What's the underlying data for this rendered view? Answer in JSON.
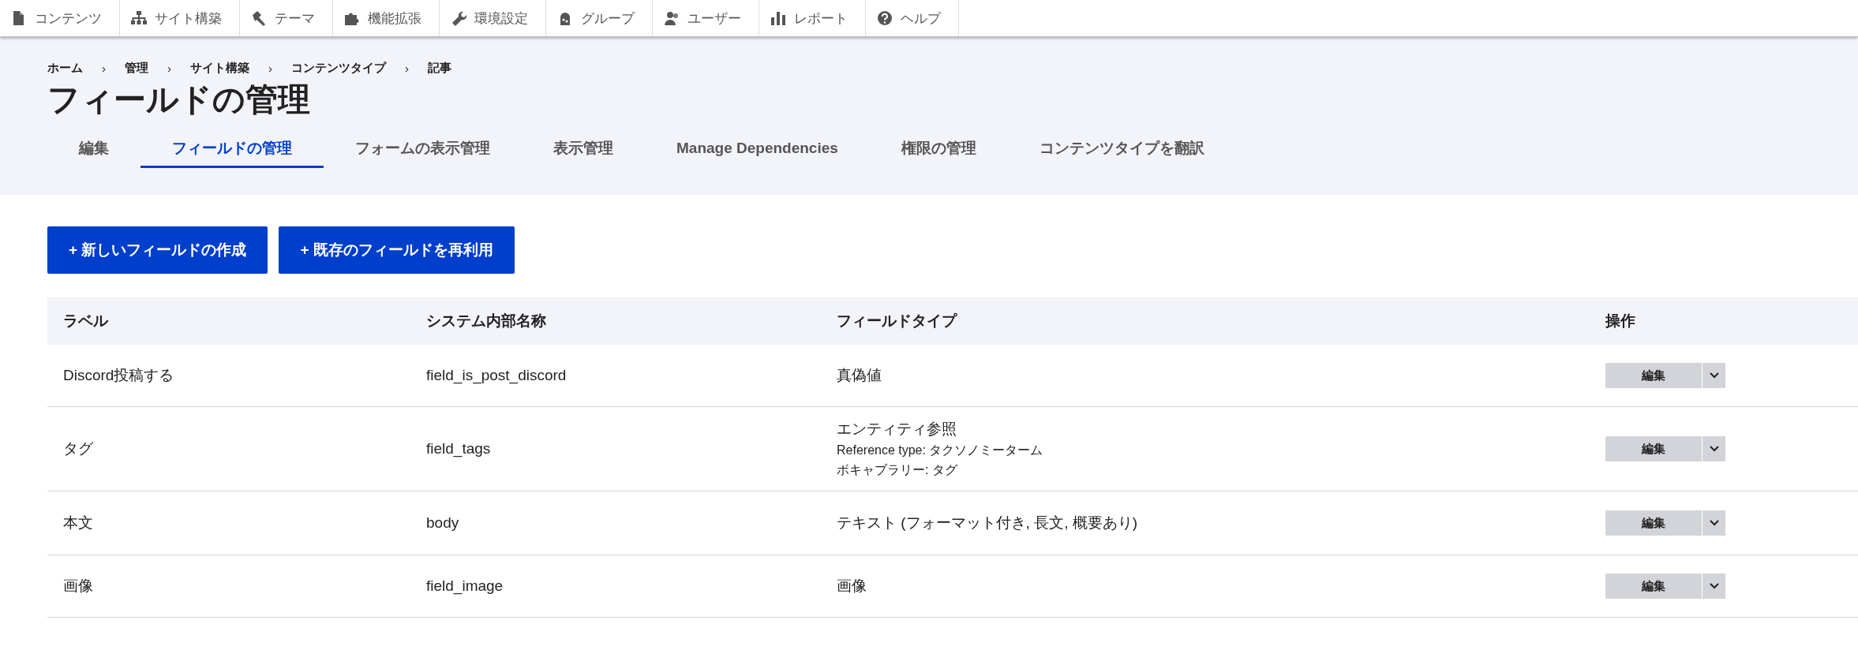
{
  "toolbar": [
    {
      "label": "コンテンツ"
    },
    {
      "label": "サイト構築"
    },
    {
      "label": "テーマ"
    },
    {
      "label": "機能拡張"
    },
    {
      "label": "環境設定"
    },
    {
      "label": "グループ"
    },
    {
      "label": "ユーザー"
    },
    {
      "label": "レポート"
    },
    {
      "label": "ヘルプ"
    }
  ],
  "breadcrumb": [
    "ホーム",
    "管理",
    "サイト構築",
    "コンテンツタイプ",
    "記事"
  ],
  "breadcrumb_separator": "›",
  "page_title": "フィールドの管理",
  "tabs": [
    {
      "label": "編集",
      "selected": false
    },
    {
      "label": "フィールドの管理",
      "selected": true
    },
    {
      "label": "フォームの表示管理",
      "selected": false
    },
    {
      "label": "表示管理",
      "selected": false
    },
    {
      "label": "Manage Dependencies",
      "selected": false
    },
    {
      "label": "権限の管理",
      "selected": false
    },
    {
      "label": "コンテンツタイプを翻訳",
      "selected": false
    }
  ],
  "actions": [
    "+ 新しいフィールドの作成",
    "+ 既存のフィールドを再利用"
  ],
  "table": {
    "columns": [
      "ラベル",
      "システム内部名称",
      "フィールドタイプ",
      "操作"
    ],
    "rows": [
      {
        "label": "Discord投稿する",
        "machine_name": "field_is_post_discord",
        "field_type": "真偽値",
        "details": [],
        "operation": "編集"
      },
      {
        "label": "タグ",
        "machine_name": "field_tags",
        "field_type": "エンティティ参照",
        "details": [
          "Reference type: タクソノミーターム",
          "ボキャブラリー: タグ"
        ],
        "operation": "編集"
      },
      {
        "label": "本文",
        "machine_name": "body",
        "field_type": "テキスト (フォーマット付き, 長文, 概要あり)",
        "details": [],
        "operation": "編集"
      },
      {
        "label": "画像",
        "machine_name": "field_image",
        "field_type": "画像",
        "details": [],
        "operation": "編集"
      }
    ]
  }
}
